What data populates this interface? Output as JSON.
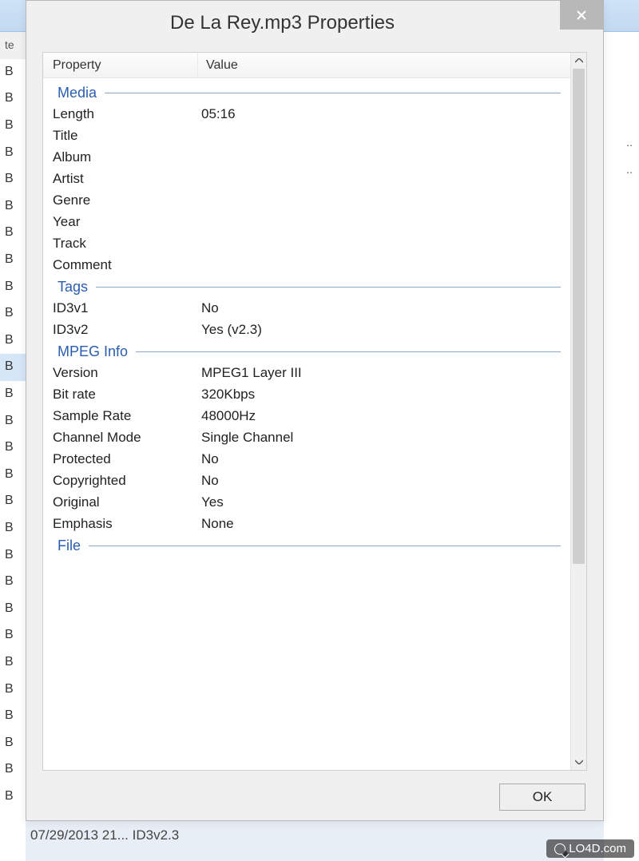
{
  "dialog": {
    "title": "De La Rey.mp3 Properties",
    "ok_label": "OK"
  },
  "columns": {
    "property": "Property",
    "value": "Value"
  },
  "sections": [
    {
      "title": "Media",
      "rows": [
        {
          "label": "Length",
          "value": "05:16"
        },
        {
          "label": "Title",
          "value": ""
        },
        {
          "label": "Album",
          "value": ""
        },
        {
          "label": "Artist",
          "value": ""
        },
        {
          "label": "Genre",
          "value": ""
        },
        {
          "label": "Year",
          "value": ""
        },
        {
          "label": "Track",
          "value": ""
        },
        {
          "label": "Comment",
          "value": ""
        }
      ]
    },
    {
      "title": "Tags",
      "rows": [
        {
          "label": "ID3v1",
          "value": "No"
        },
        {
          "label": "ID3v2",
          "value": "Yes (v2.3)"
        }
      ]
    },
    {
      "title": "MPEG Info",
      "rows": [
        {
          "label": "Version",
          "value": "MPEG1 Layer III"
        },
        {
          "label": "Bit rate",
          "value": "320Kbps"
        },
        {
          "label": "Sample Rate",
          "value": "48000Hz"
        },
        {
          "label": "Channel Mode",
          "value": "Single Channel"
        },
        {
          "label": "Protected",
          "value": "No"
        },
        {
          "label": "Copyrighted",
          "value": "No"
        },
        {
          "label": "Original",
          "value": "Yes"
        },
        {
          "label": "Emphasis",
          "value": "None"
        }
      ]
    },
    {
      "title": "File",
      "rows": []
    }
  ],
  "background": {
    "head": "te",
    "item": "B",
    "dots": "..",
    "bottom_text": "07/29/2013 21...   ID3v2.3"
  },
  "watermark": "LO4D.com"
}
